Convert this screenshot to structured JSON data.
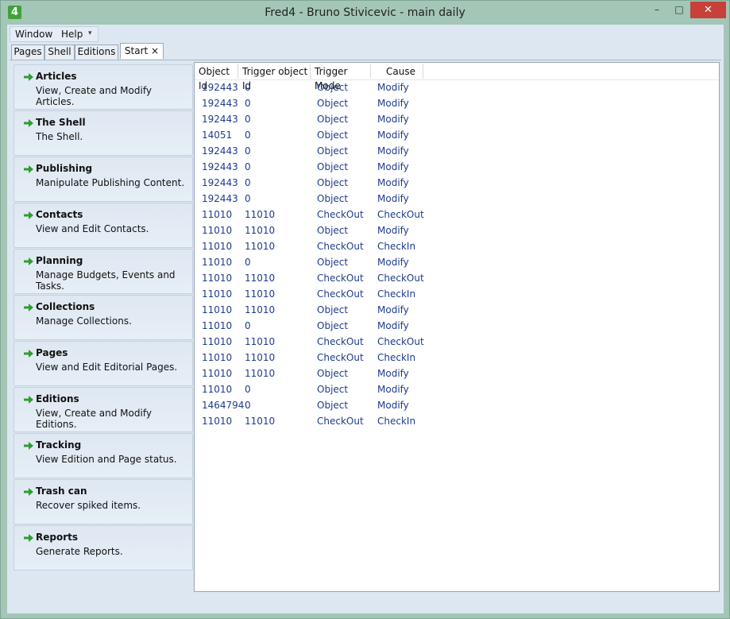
{
  "window": {
    "title": "Fred4 - Bruno Stivicevic - main daily",
    "icon_label": "4",
    "minimize_glyph": "–",
    "maximize_glyph": "□",
    "close_glyph": "✕"
  },
  "menu": {
    "window_label": "Window",
    "help_label": "Help",
    "more_glyph": "▾"
  },
  "tabs": [
    {
      "label": "Pages"
    },
    {
      "label": "Shell"
    },
    {
      "label": "Editions"
    },
    {
      "label": "Start ×"
    }
  ],
  "sidebar": {
    "arrow_color": "#2e9e2e",
    "items": [
      {
        "title": "Articles",
        "desc": "View, Create and Modify Articles."
      },
      {
        "title": "The Shell",
        "desc": "The Shell."
      },
      {
        "title": "Publishing",
        "desc": "Manipulate Publishing Content."
      },
      {
        "title": "Contacts",
        "desc": "View and Edit Contacts."
      },
      {
        "title": "Planning",
        "desc": "Manage Budgets, Events and Tasks."
      },
      {
        "title": "Collections",
        "desc": "Manage Collections."
      },
      {
        "title": "Pages",
        "desc": "View and Edit Editorial Pages."
      },
      {
        "title": "Editions",
        "desc": "View, Create and Modify Editions."
      },
      {
        "title": "Tracking",
        "desc": "View Edition and Page status."
      },
      {
        "title": "Trash can",
        "desc": "Recover spiked items."
      },
      {
        "title": "Reports",
        "desc": "Generate Reports."
      }
    ]
  },
  "grid": {
    "columns": [
      "Object Id",
      "Trigger object Id",
      "Trigger Mode",
      "Cause"
    ],
    "rows": [
      [
        "192443",
        "0",
        "Object",
        "Modify"
      ],
      [
        "192443",
        "0",
        "Object",
        "Modify"
      ],
      [
        "192443",
        "0",
        "Object",
        "Modify"
      ],
      [
        "14051",
        "0",
        "Object",
        "Modify"
      ],
      [
        "192443",
        "0",
        "Object",
        "Modify"
      ],
      [
        "192443",
        "0",
        "Object",
        "Modify"
      ],
      [
        "192443",
        "0",
        "Object",
        "Modify"
      ],
      [
        "192443",
        "0",
        "Object",
        "Modify"
      ],
      [
        "11010",
        "11010",
        "CheckOut",
        "CheckOut"
      ],
      [
        "11010",
        "11010",
        "Object",
        "Modify"
      ],
      [
        "11010",
        "11010",
        "CheckOut",
        "CheckIn"
      ],
      [
        "11010",
        "0",
        "Object",
        "Modify"
      ],
      [
        "11010",
        "11010",
        "CheckOut",
        "CheckOut"
      ],
      [
        "11010",
        "11010",
        "CheckOut",
        "CheckIn"
      ],
      [
        "11010",
        "11010",
        "Object",
        "Modify"
      ],
      [
        "11010",
        "0",
        "Object",
        "Modify"
      ],
      [
        "11010",
        "11010",
        "CheckOut",
        "CheckOut"
      ],
      [
        "11010",
        "11010",
        "CheckOut",
        "CheckIn"
      ],
      [
        "11010",
        "11010",
        "Object",
        "Modify"
      ],
      [
        "11010",
        "0",
        "Object",
        "Modify"
      ],
      [
        "1464794",
        "0",
        "Object",
        "Modify"
      ],
      [
        "11010",
        "11010",
        "CheckOut",
        "CheckIn"
      ]
    ]
  }
}
